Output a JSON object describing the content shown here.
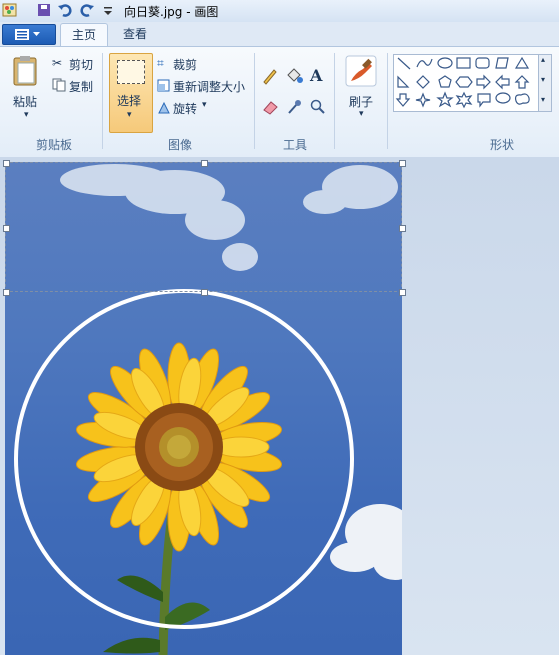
{
  "window": {
    "title": "向日葵.jpg - 画图"
  },
  "tabs": [
    {
      "label": "主页"
    },
    {
      "label": "查看"
    }
  ],
  "clipboard": {
    "paste": "粘贴",
    "cut": "剪切",
    "copy": "复制",
    "group": "剪贴板"
  },
  "image_group": {
    "select": "选择",
    "crop": "裁剪",
    "resize": "重新调整大小",
    "rotate": "旋转",
    "group": "图像"
  },
  "tools": {
    "group": "工具"
  },
  "brushes": {
    "label": "刷子"
  },
  "shapes": {
    "group": "形状"
  },
  "colors": {
    "accent": "#f6c97a",
    "sky": "#4a74bc",
    "petal": "#f7c21b"
  }
}
